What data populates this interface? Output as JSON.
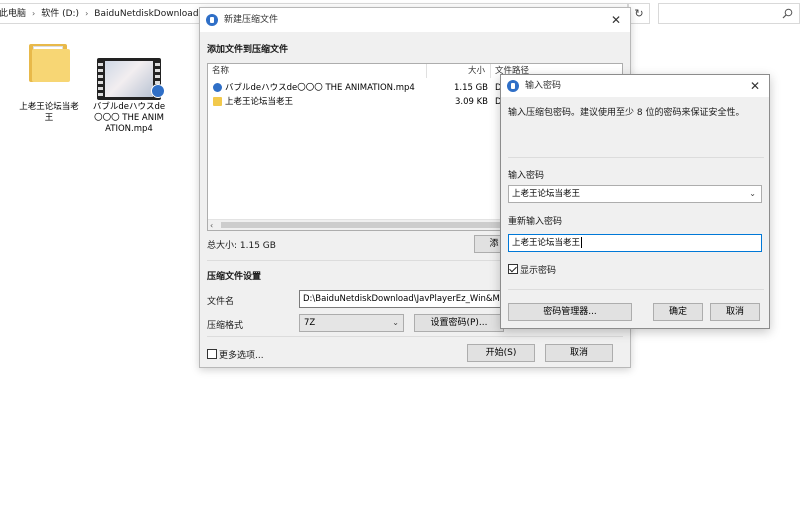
{
  "explorer": {
    "breadcrumb": [
      "此电脑",
      "软件 (D:)",
      "BaiduNetdiskDownload"
    ],
    "refresh_icon": "refresh-icon",
    "search_icon": "search-icon",
    "desktop_items": [
      {
        "label": "上老王论坛当老王",
        "type": "folder"
      },
      {
        "label": "バブルdeハウスde〇〇〇 THE ANIMATION.mp4",
        "type": "video"
      }
    ]
  },
  "compress_dialog": {
    "title": "新建压缩文件",
    "add_section": "添加文件到压缩文件",
    "columns": {
      "name": "名称",
      "size": "大小",
      "path": "文件路径"
    },
    "files": [
      {
        "name": "バブルdeハウスde〇〇〇 THE ANIMATION.mp4",
        "size": "1.15 GB",
        "path": "D",
        "icon": "video-file-icon"
      },
      {
        "name": "上老王论坛当老王",
        "size": "3.09 KB",
        "path": "D",
        "icon": "folder-icon"
      }
    ],
    "total_size": "总大小: 1.15 GB",
    "add_button": "添",
    "settings_section": "压缩文件设置",
    "filename_label": "文件名",
    "filename_value": "D:\\BaiduNetdiskDownload\\JavPlayerEz_Win&Ma",
    "format_label": "压缩格式",
    "format_value": "7Z",
    "set_password_button": "设置密码(P)...",
    "more_options_label": "更多选项...",
    "more_options_checked": false,
    "start_button": "开始(S)",
    "cancel_button": "取消"
  },
  "password_dialog": {
    "title": "输入密码",
    "hint": "输入压缩包密码。建议使用至少 8 位的密码来保证安全性。",
    "password_label": "输入密码",
    "password_value": "上老王论坛当老王",
    "reenter_label": "重新输入密码",
    "reenter_value": "上老王论坛当老王",
    "show_password_label": "显示密码",
    "show_password_checked": true,
    "manager_button": "密码管理器...",
    "ok_button": "确定",
    "cancel_button": "取消"
  },
  "colors": {
    "accent": "#2f6fc7",
    "dialog_bg": "#f0f0f0",
    "focus_border": "#0078d7",
    "folder_yellow": "#f7d674"
  }
}
